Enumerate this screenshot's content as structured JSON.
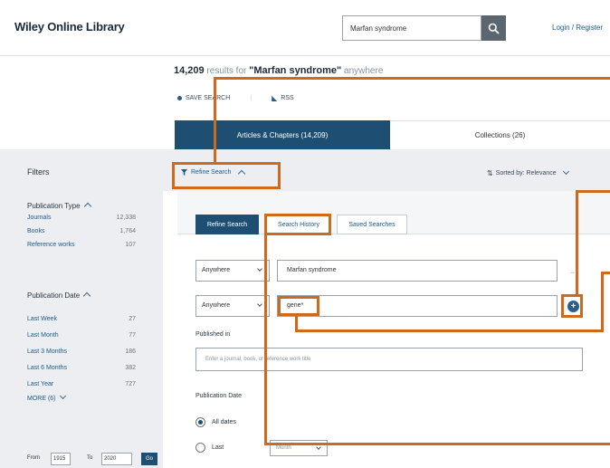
{
  "header": {
    "logo": "Wiley Online Library",
    "search_value": "Marfan syndrome",
    "login_label": "Login / Register"
  },
  "results": {
    "count": "14,209",
    "mid": " results for ",
    "query": "\"Marfan syndrome\"",
    "tail": " anywhere",
    "save_search": "SAVE SEARCH",
    "rss": "RSS"
  },
  "main_tabs": {
    "articles": "Articles & Chapters (14,209)",
    "collections": "Collections (26)"
  },
  "toolbar": {
    "refine_label": "Refine Search",
    "sorted_label": "Sorted by: Relevance"
  },
  "filters": {
    "title": "Filters",
    "publication_type": "Publication Type",
    "types": [
      {
        "label": "Journals",
        "count": "12,338"
      },
      {
        "label": "Books",
        "count": "1,764"
      },
      {
        "label": "Reference works",
        "count": "107"
      }
    ],
    "publication_date": "Publication Date",
    "dates": [
      {
        "label": "Last Week",
        "count": "27"
      },
      {
        "label": "Last Month",
        "count": "77"
      },
      {
        "label": "Last 3 Months",
        "count": "186"
      },
      {
        "label": "Last 6 Months",
        "count": "382"
      },
      {
        "label": "Last Year",
        "count": "727"
      }
    ],
    "more": "MORE (6)",
    "from_label": "From",
    "from_value": "1915",
    "to_label": "To",
    "to_value": "2020",
    "go_label": "Go"
  },
  "refine_tabs": {
    "refine": "Refine Search",
    "history": "Search History",
    "saved": "Saved Searches"
  },
  "rows": [
    {
      "field": "Anywhere",
      "value": "Marfan syndrome"
    },
    {
      "field": "Anywhere",
      "value": "gene*"
    }
  ],
  "form": {
    "published_in_label": "Published in",
    "published_in_placeholder": "Enter a journal, book, or reference work title",
    "pub_date_label": "Publication Date",
    "all_dates": "All dates",
    "last": "Last",
    "month": "Month"
  },
  "colors": {
    "primary": "#1e4f72",
    "annotation": "#cc6a1e",
    "sidebar_bg": "#eceef1"
  }
}
